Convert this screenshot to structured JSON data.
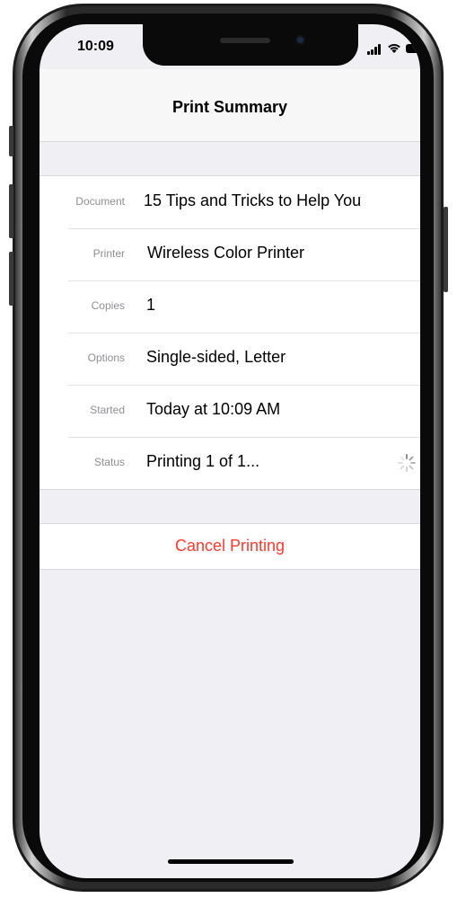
{
  "status_bar": {
    "time": "10:09",
    "signal_icon": "cellular-signal-icon",
    "wifi_icon": "wifi-icon",
    "battery_icon": "battery-icon"
  },
  "nav": {
    "title": "Print Summary"
  },
  "summary": {
    "rows": [
      {
        "label": "Document",
        "value": "15 Tips and Tricks to Help You"
      },
      {
        "label": "Printer",
        "value": "Wireless Color Printer"
      },
      {
        "label": "Copies",
        "value": "1"
      },
      {
        "label": "Options",
        "value": "Single-sided, Letter"
      },
      {
        "label": "Started",
        "value": "Today at 10:09 AM"
      },
      {
        "label": "Status",
        "value": "Printing 1 of 1..."
      }
    ],
    "status_indicator_icon": "activity-spinner-icon"
  },
  "actions": {
    "cancel_label": "Cancel Printing"
  },
  "colors": {
    "destructive": "#ff3b30",
    "background": "#efeff4",
    "label_gray": "#8e8e93"
  }
}
